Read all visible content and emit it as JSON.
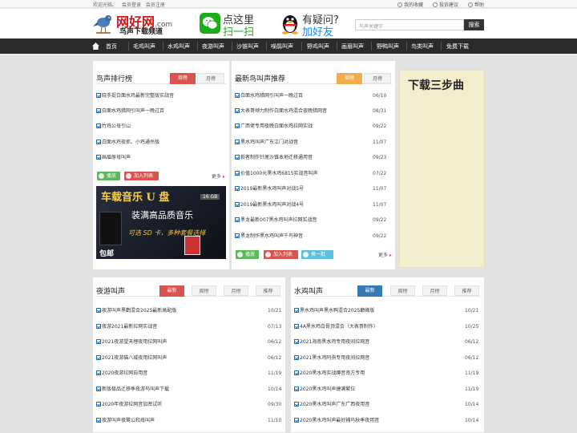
{
  "topbar": {
    "welcome": "欢迎光临。",
    "login": "会员登录",
    "register": "会员注册",
    "favorites": "我的收藏",
    "feedback": "投诉建议",
    "help": "帮助"
  },
  "header": {
    "logo_main": "网好网",
    "logo_domain": ".com",
    "logo_sub": "鸟声下载频道",
    "wechat_line1": "点这里",
    "wechat_line2": "扫一扫",
    "qq_line1": "有疑问?",
    "qq_line2": "加好友",
    "search_placeholder": "鸟声关键字",
    "search_button": "搜索"
  },
  "nav": [
    "首页",
    "毛鸡叫声",
    "水鸡叫声",
    "夜游叫声",
    "沙锥叫声",
    "噪鹃叫声",
    "野鸡叫声",
    "画眉叫声",
    "野鸭叫声",
    "鸟类叫声",
    "免费下载"
  ],
  "ranking": {
    "title": "鸟声排行榜",
    "tab_week": "周榜",
    "tab_month": "月榜",
    "items": [
      "晓手捉白面水鸡最新完整版实战音",
      "白面水鸡猎网引叫声一晚过百",
      "竹鸡公母引山",
      "白面水鸡夜抓、小鸡通杀版",
      "画眉原母叫声"
    ],
    "play": "播放",
    "add": "加入列表",
    "more": "更多"
  },
  "banner": {
    "title": "车载音乐 U 盘",
    "capacity": "16 GB",
    "line": "装满高品质音乐",
    "slogan": "可选 SD 卡，多种套餐选择",
    "free_ship": "包邮"
  },
  "latest": {
    "title": "最新鸟叫声推荐",
    "tab_week": "周榜",
    "tab_month": "月榜",
    "items": [
      {
        "title": "白面水鸡猎网引叫声一晚过百",
        "date": "06/10"
      },
      {
        "title": "大表哥倾力制作白面水鸡混合夜晚猎网音",
        "date": "08/31"
      },
      {
        "title": "广西佬专用夜晚白面水鸡拉网实战",
        "date": "09/22"
      },
      {
        "title": "黑水鸡叫声广东江门对战音",
        "date": "11/07"
      },
      {
        "title": "毅者制作针尾沙锥本地迁移通用音",
        "date": "09/23"
      },
      {
        "title": "价值1000元黑水鸡6815实战音叫声",
        "date": "07/22"
      },
      {
        "title": "2019最新黑水鸡叫声对战5号",
        "date": "11/07"
      },
      {
        "title": "2019最新黑水鸡叫声对战4号",
        "date": "11/07"
      },
      {
        "title": "黑龙最新007黑水鸡叫声拉网实战音",
        "date": "09/22"
      },
      {
        "title": "黑龙制作黑水鸡叫声千鸟神音",
        "date": "09/22"
      }
    ],
    "play": "播放",
    "add": "加入列表",
    "swap": "换一批",
    "more": "更多"
  },
  "steps": {
    "title": "下载三步曲"
  },
  "night": {
    "title": "夜游叫声",
    "tabs": [
      "最新",
      "周榜",
      "月榜",
      "推荐"
    ],
    "items": [
      {
        "title": "夜游叫声黑鹳混合2025最新高配版",
        "date": "10/21"
      },
      {
        "title": "夜游2021最新拉网实战音",
        "date": "07/13"
      },
      {
        "title": "2021夜游望天埋夜用拉网叫声",
        "date": "06/12"
      },
      {
        "title": "2021夜游猫八威夜用拉网叫声",
        "date": "06/12"
      },
      {
        "title": "2020夜游拉网自用音",
        "date": "11/19"
      },
      {
        "title": "新版极品迁移季夜游鸟叫声下载",
        "date": "10/14"
      },
      {
        "title": "2020年夜游拉网音加密试听",
        "date": "09/30"
      },
      {
        "title": "夜游叫声夜鹭公和母叫声",
        "date": "11/10"
      }
    ]
  },
  "water": {
    "title": "水鸡叫声",
    "tabs": [
      "最新",
      "周榜",
      "月榜",
      "推荐"
    ],
    "items": [
      {
        "title": "黑水鸡叫声黑水鸭混合2025巅峰版",
        "date": "10/21"
      },
      {
        "title": "4A黑水鸡白骨顶混合（大表哥制作）",
        "date": "10/25"
      },
      {
        "title": "2021海南黑水鸡专用夜间拉网音",
        "date": "06/12"
      },
      {
        "title": "2021黑水鸡阿驹专用夜间拉网音",
        "date": "06/12"
      },
      {
        "title": "2020黑水鸡实战蹲音南方专用",
        "date": "11/19"
      },
      {
        "title": "2020黑水鸡叫声捷满繁位",
        "date": "11/19"
      },
      {
        "title": "2020黑水鸡叫声广东广西夜用音",
        "date": "10/14"
      },
      {
        "title": "2020黑水鸡叫声最好捕鸟秋季夜用音",
        "date": "10/14"
      }
    ]
  },
  "colors": {
    "accent_red": "#d9534f",
    "accent_orange": "#f0ad4e",
    "accent_blue": "#337ab7",
    "nav_bg": "#2b2b2b",
    "logo_red": "#d0161b"
  }
}
